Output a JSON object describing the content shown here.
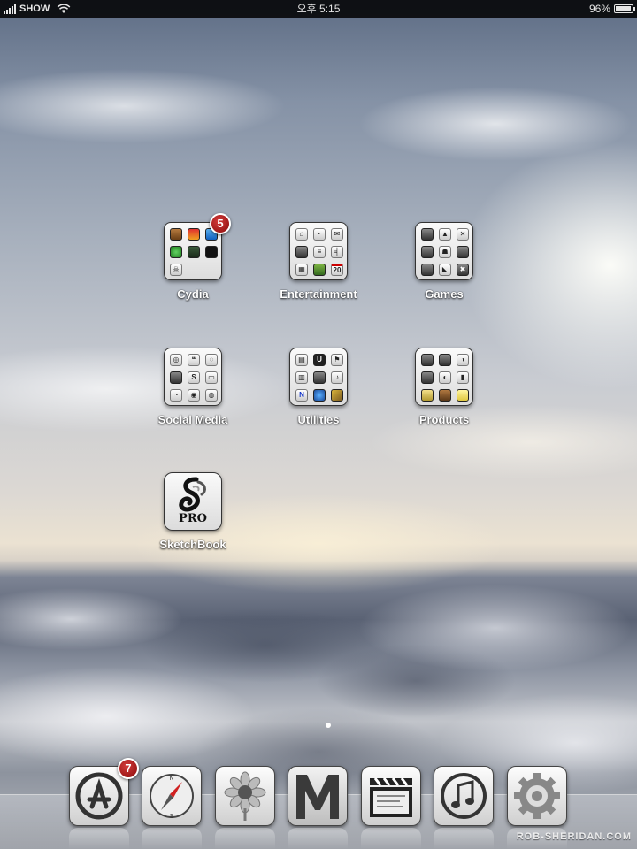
{
  "status_bar": {
    "carrier": "SHOW",
    "time": "오후 5:15",
    "battery_text": "96%",
    "battery_level": 0.96,
    "signal_bars": 5
  },
  "folders": [
    {
      "label": "Cydia",
      "badge": "5",
      "icons": [
        "cydia",
        "rainbow",
        "blue",
        "green-circle",
        "green-down",
        "terminal",
        "skull",
        "",
        ""
      ]
    },
    {
      "label": "Entertainment",
      "badge": "",
      "icons": [
        "house",
        "dot",
        "envelope",
        "tv",
        "bars",
        "tool",
        "grid",
        "plant",
        "20"
      ]
    },
    {
      "label": "Games",
      "badge": "",
      "icons": [
        "game",
        "game",
        "game",
        "game",
        "game",
        "game",
        "game",
        "game",
        "game"
      ]
    },
    {
      "label": "Social Media",
      "badge": "",
      "icons": [
        "chat",
        "chat",
        "chat",
        "chat",
        "chat",
        "chat",
        "chat",
        "chat",
        "chat"
      ]
    },
    {
      "label": "Utilities",
      "badge": "",
      "icons": [
        "kbd",
        "U",
        "flag",
        "ctrl",
        "screen",
        "note",
        "N",
        "globe",
        "photo"
      ]
    },
    {
      "label": "Products",
      "badge": "",
      "icons": [
        "prod",
        "prod",
        "prod",
        "prod",
        "prod",
        "prod",
        "folder",
        "brown",
        "notes"
      ]
    }
  ],
  "apps": [
    {
      "label": "SketchBook",
      "icon_name": "sketchbook-pro-icon",
      "pro_text": "PRO"
    }
  ],
  "dock": [
    {
      "name": "app-store-icon",
      "badge": "7"
    },
    {
      "name": "safari-compass-icon",
      "badge": ""
    },
    {
      "name": "photos-sunflower-icon",
      "badge": ""
    },
    {
      "name": "mail-m-icon",
      "badge": ""
    },
    {
      "name": "videos-clapperboard-icon",
      "badge": ""
    },
    {
      "name": "ipod-music-icon",
      "badge": ""
    },
    {
      "name": "settings-gear-icon",
      "badge": ""
    }
  ],
  "page_indicator": {
    "pages": 1,
    "current": 1
  },
  "watermark": "ROB-SHERIDAN.COM",
  "colors": {
    "badge_red": "#a81616",
    "status_bar": "#000000",
    "label_text": "#ffffff"
  }
}
